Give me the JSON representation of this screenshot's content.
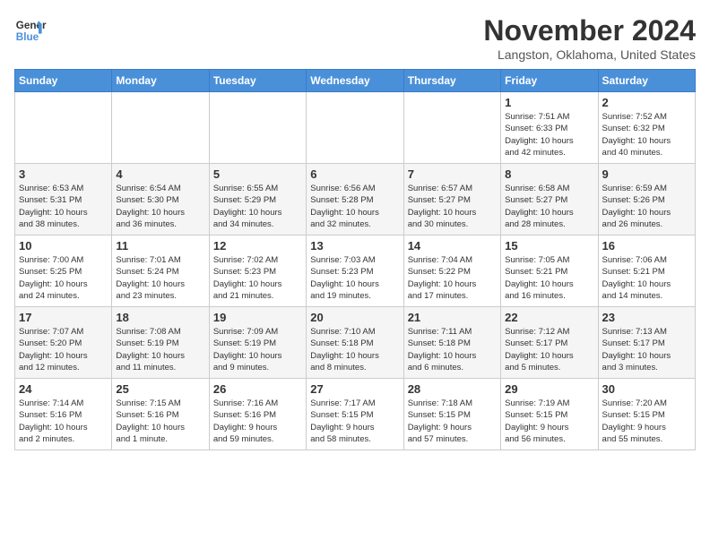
{
  "header": {
    "logo_line1": "General",
    "logo_line2": "Blue",
    "month": "November 2024",
    "location": "Langston, Oklahoma, United States"
  },
  "weekdays": [
    "Sunday",
    "Monday",
    "Tuesday",
    "Wednesday",
    "Thursday",
    "Friday",
    "Saturday"
  ],
  "weeks": [
    [
      {
        "day": "",
        "info": ""
      },
      {
        "day": "",
        "info": ""
      },
      {
        "day": "",
        "info": ""
      },
      {
        "day": "",
        "info": ""
      },
      {
        "day": "",
        "info": ""
      },
      {
        "day": "1",
        "info": "Sunrise: 7:51 AM\nSunset: 6:33 PM\nDaylight: 10 hours\nand 42 minutes."
      },
      {
        "day": "2",
        "info": "Sunrise: 7:52 AM\nSunset: 6:32 PM\nDaylight: 10 hours\nand 40 minutes."
      }
    ],
    [
      {
        "day": "3",
        "info": "Sunrise: 6:53 AM\nSunset: 5:31 PM\nDaylight: 10 hours\nand 38 minutes."
      },
      {
        "day": "4",
        "info": "Sunrise: 6:54 AM\nSunset: 5:30 PM\nDaylight: 10 hours\nand 36 minutes."
      },
      {
        "day": "5",
        "info": "Sunrise: 6:55 AM\nSunset: 5:29 PM\nDaylight: 10 hours\nand 34 minutes."
      },
      {
        "day": "6",
        "info": "Sunrise: 6:56 AM\nSunset: 5:28 PM\nDaylight: 10 hours\nand 32 minutes."
      },
      {
        "day": "7",
        "info": "Sunrise: 6:57 AM\nSunset: 5:27 PM\nDaylight: 10 hours\nand 30 minutes."
      },
      {
        "day": "8",
        "info": "Sunrise: 6:58 AM\nSunset: 5:27 PM\nDaylight: 10 hours\nand 28 minutes."
      },
      {
        "day": "9",
        "info": "Sunrise: 6:59 AM\nSunset: 5:26 PM\nDaylight: 10 hours\nand 26 minutes."
      }
    ],
    [
      {
        "day": "10",
        "info": "Sunrise: 7:00 AM\nSunset: 5:25 PM\nDaylight: 10 hours\nand 24 minutes."
      },
      {
        "day": "11",
        "info": "Sunrise: 7:01 AM\nSunset: 5:24 PM\nDaylight: 10 hours\nand 23 minutes."
      },
      {
        "day": "12",
        "info": "Sunrise: 7:02 AM\nSunset: 5:23 PM\nDaylight: 10 hours\nand 21 minutes."
      },
      {
        "day": "13",
        "info": "Sunrise: 7:03 AM\nSunset: 5:23 PM\nDaylight: 10 hours\nand 19 minutes."
      },
      {
        "day": "14",
        "info": "Sunrise: 7:04 AM\nSunset: 5:22 PM\nDaylight: 10 hours\nand 17 minutes."
      },
      {
        "day": "15",
        "info": "Sunrise: 7:05 AM\nSunset: 5:21 PM\nDaylight: 10 hours\nand 16 minutes."
      },
      {
        "day": "16",
        "info": "Sunrise: 7:06 AM\nSunset: 5:21 PM\nDaylight: 10 hours\nand 14 minutes."
      }
    ],
    [
      {
        "day": "17",
        "info": "Sunrise: 7:07 AM\nSunset: 5:20 PM\nDaylight: 10 hours\nand 12 minutes."
      },
      {
        "day": "18",
        "info": "Sunrise: 7:08 AM\nSunset: 5:19 PM\nDaylight: 10 hours\nand 11 minutes."
      },
      {
        "day": "19",
        "info": "Sunrise: 7:09 AM\nSunset: 5:19 PM\nDaylight: 10 hours\nand 9 minutes."
      },
      {
        "day": "20",
        "info": "Sunrise: 7:10 AM\nSunset: 5:18 PM\nDaylight: 10 hours\nand 8 minutes."
      },
      {
        "day": "21",
        "info": "Sunrise: 7:11 AM\nSunset: 5:18 PM\nDaylight: 10 hours\nand 6 minutes."
      },
      {
        "day": "22",
        "info": "Sunrise: 7:12 AM\nSunset: 5:17 PM\nDaylight: 10 hours\nand 5 minutes."
      },
      {
        "day": "23",
        "info": "Sunrise: 7:13 AM\nSunset: 5:17 PM\nDaylight: 10 hours\nand 3 minutes."
      }
    ],
    [
      {
        "day": "24",
        "info": "Sunrise: 7:14 AM\nSunset: 5:16 PM\nDaylight: 10 hours\nand 2 minutes."
      },
      {
        "day": "25",
        "info": "Sunrise: 7:15 AM\nSunset: 5:16 PM\nDaylight: 10 hours\nand 1 minute."
      },
      {
        "day": "26",
        "info": "Sunrise: 7:16 AM\nSunset: 5:16 PM\nDaylight: 9 hours\nand 59 minutes."
      },
      {
        "day": "27",
        "info": "Sunrise: 7:17 AM\nSunset: 5:15 PM\nDaylight: 9 hours\nand 58 minutes."
      },
      {
        "day": "28",
        "info": "Sunrise: 7:18 AM\nSunset: 5:15 PM\nDaylight: 9 hours\nand 57 minutes."
      },
      {
        "day": "29",
        "info": "Sunrise: 7:19 AM\nSunset: 5:15 PM\nDaylight: 9 hours\nand 56 minutes."
      },
      {
        "day": "30",
        "info": "Sunrise: 7:20 AM\nSunset: 5:15 PM\nDaylight: 9 hours\nand 55 minutes."
      }
    ]
  ]
}
